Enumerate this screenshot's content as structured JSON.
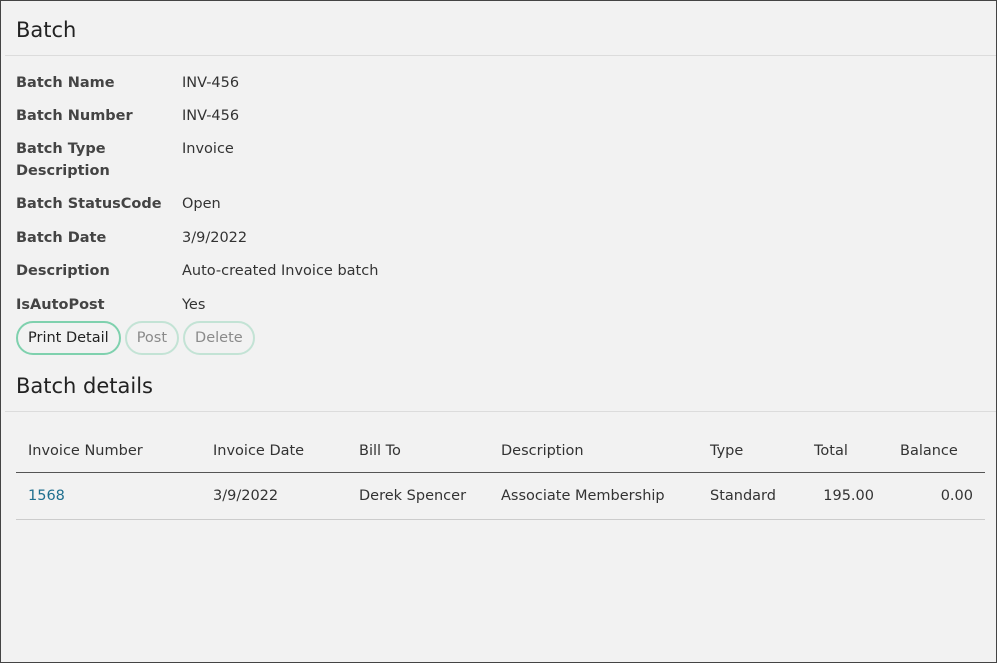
{
  "page": {
    "title": "Batch"
  },
  "batch": {
    "fields": [
      {
        "label": "Batch Name",
        "value": "INV-456"
      },
      {
        "label": "Batch Number",
        "value": "INV-456"
      },
      {
        "label": "Batch Type Description",
        "value": "Invoice"
      },
      {
        "label": "Batch StatusCode",
        "value": "Open"
      },
      {
        "label": "Batch Date",
        "value": "3/9/2022"
      },
      {
        "label": "Description",
        "value": "Auto-created Invoice batch"
      },
      {
        "label": "IsAutoPost",
        "value": "Yes"
      }
    ]
  },
  "actions": {
    "print_detail": "Print Detail",
    "post": "Post",
    "delete": "Delete"
  },
  "details": {
    "title": "Batch details",
    "columns": [
      "Invoice Number",
      "Invoice Date",
      "Bill To",
      "Description",
      "Type",
      "Total",
      "Balance"
    ],
    "rows": [
      {
        "invoice_number": "1568",
        "invoice_date": "3/9/2022",
        "bill_to": "Derek Spencer",
        "description": "Associate Membership",
        "type": "Standard",
        "total": "195.00",
        "balance": "0.00"
      }
    ]
  },
  "colors": {
    "background": "#f2f2f2",
    "accent_border": "#7fd1ae",
    "link": "#1f6f8f"
  }
}
